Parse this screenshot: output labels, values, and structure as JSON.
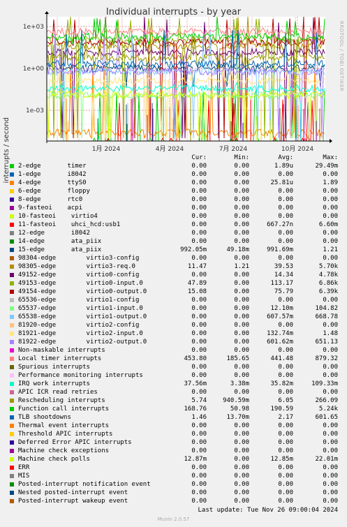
{
  "title": "Individual interrupts - by year",
  "side_label": "RRDTOOL / TOBI OETIKER",
  "munin_version": "Munin 2.0.57",
  "last_update": "Last update: Tue Nov 26 09:00:04 2024",
  "columns": {
    "cur": "Cur:",
    "min": "Min:",
    "avg": "Avg:",
    "max": "Max:"
  },
  "chart_data": {
    "type": "line",
    "title": "Individual interrupts - by year",
    "ylabel": "interrupts / second",
    "yscale": "log",
    "y_ticks": [
      "1e+03",
      "1e+00",
      "1e-03"
    ],
    "x_ticks": [
      "1月 2024",
      "4月 2024",
      "7月 2024",
      "10月 2024"
    ],
    "grid": true,
    "legend_placement": "bottom",
    "series_summary": [
      {
        "name": "2-edge       timer",
        "color": "#00cc00",
        "cur": "0.00",
        "min": "0.00",
        "avg": "1.89u",
        "max": "29.49m"
      },
      {
        "name": "1-edge       i8042",
        "color": "#0066b3",
        "cur": "0.00",
        "min": "0.00",
        "avg": "0.00",
        "max": "0.00"
      },
      {
        "name": "4-edge       ttyS0",
        "color": "#ff8000",
        "cur": "0.00",
        "min": "0.00",
        "avg": "25.81u",
        "max": "1.89"
      },
      {
        "name": "6-edge       floppy",
        "color": "#ffcc00",
        "cur": "0.00",
        "min": "0.00",
        "avg": "0.00",
        "max": "0.00"
      },
      {
        "name": "8-edge       rtc0",
        "color": "#330099",
        "cur": "0.00",
        "min": "0.00",
        "avg": "0.00",
        "max": "0.00"
      },
      {
        "name": "9-fasteoi    acpi",
        "color": "#990099",
        "cur": "0.00",
        "min": "0.00",
        "avg": "0.00",
        "max": "0.00"
      },
      {
        "name": "10-fasteoi    virtio4",
        "color": "#ccff00",
        "cur": "0.00",
        "min": "0.00",
        "avg": "0.00",
        "max": "0.00"
      },
      {
        "name": "11-fasteoi    uhci_hcd:usb1",
        "color": "#ff0000",
        "cur": "0.00",
        "min": "0.00",
        "avg": "667.27n",
        "max": "6.60m"
      },
      {
        "name": "12-edge       i8042",
        "color": "#808080",
        "cur": "0.00",
        "min": "0.00",
        "avg": "0.00",
        "max": "0.00"
      },
      {
        "name": "14-edge       ata_piix",
        "color": "#008f00",
        "cur": "0.00",
        "min": "0.00",
        "avg": "0.00",
        "max": "0.00"
      },
      {
        "name": "15-edge       ata_piix",
        "color": "#00487d",
        "cur": "992.05m",
        "min": "49.18m",
        "avg": "991.69m",
        "max": "1.21"
      },
      {
        "name": "98304-edge        virtio3-config",
        "color": "#b35a00",
        "cur": "0.00",
        "min": "0.00",
        "avg": "0.00",
        "max": "0.00"
      },
      {
        "name": "98305-edge        virtio3-req.0",
        "color": "#b38f00",
        "cur": "11.47",
        "min": "1.21",
        "avg": "39.53",
        "max": "5.70k"
      },
      {
        "name": "49152-edge        virtio0-config",
        "color": "#6b006b",
        "cur": "0.00",
        "min": "0.00",
        "avg": "14.34",
        "max": "4.78k"
      },
      {
        "name": "49153-edge        virtio0-input.0",
        "color": "#8fb300",
        "cur": "47.89",
        "min": "0.00",
        "avg": "113.17",
        "max": "6.86k"
      },
      {
        "name": "49154-edge        virtio0-output.0",
        "color": "#b30000",
        "cur": "15.08",
        "min": "0.00",
        "avg": "75.79",
        "max": "6.39k"
      },
      {
        "name": "65536-edge        virtio1-config",
        "color": "#bebebe",
        "cur": "0.00",
        "min": "0.00",
        "avg": "0.00",
        "max": "0.00"
      },
      {
        "name": "65537-edge        virtio1-input.0",
        "color": "#80ff80",
        "cur": "0.00",
        "min": "0.00",
        "avg": "12.10m",
        "max": "104.82"
      },
      {
        "name": "65538-edge        virtio1-output.0",
        "color": "#80c9ff",
        "cur": "0.00",
        "min": "0.00",
        "avg": "607.57m",
        "max": "668.78"
      },
      {
        "name": "81920-edge        virtio2-config",
        "color": "#ffc080",
        "cur": "0.00",
        "min": "0.00",
        "avg": "0.00",
        "max": "0.00"
      },
      {
        "name": "81921-edge        virtio2-input.0",
        "color": "#ffe680",
        "cur": "0.00",
        "min": "0.00",
        "avg": "132.74m",
        "max": "1.48"
      },
      {
        "name": "81922-edge        virtio2-output.0",
        "color": "#aa80ff",
        "cur": "0.00",
        "min": "0.00",
        "avg": "601.62m",
        "max": "651.13"
      },
      {
        "name": "Non-maskable interrupts",
        "color": "#ee00cc",
        "cur": "0.00",
        "min": "0.00",
        "avg": "0.00",
        "max": "0.00"
      },
      {
        "name": "Local timer interrupts",
        "color": "#ff8080",
        "cur": "453.80",
        "min": "185.65",
        "avg": "441.48",
        "max": "879.32"
      },
      {
        "name": "Spurious interrupts",
        "color": "#666600",
        "cur": "0.00",
        "min": "0.00",
        "avg": "0.00",
        "max": "0.00"
      },
      {
        "name": "Performance monitoring interrupts",
        "color": "#ffbfff",
        "cur": "0.00",
        "min": "0.00",
        "avg": "0.00",
        "max": "0.00"
      },
      {
        "name": "IRQ work interrupts",
        "color": "#00ffcc",
        "cur": "37.56m",
        "min": "3.38m",
        "avg": "35.82m",
        "max": "109.33m"
      },
      {
        "name": "APIC ICR read retries",
        "color": "#cc6699",
        "cur": "0.00",
        "min": "0.00",
        "avg": "0.00",
        "max": "0.00"
      },
      {
        "name": "Rescheduling interrupts",
        "color": "#999900",
        "cur": "5.74",
        "min": "940.59m",
        "avg": "6.05",
        "max": "266.09"
      },
      {
        "name": "Function call interrupts",
        "color": "#00cc00",
        "cur": "168.76",
        "min": "50.98",
        "avg": "190.59",
        "max": "5.24k"
      },
      {
        "name": "TLB shootdowns",
        "color": "#0066b3",
        "cur": "1.46",
        "min": "13.70m",
        "avg": "2.17",
        "max": "601.65"
      },
      {
        "name": "Thermal event interrupts",
        "color": "#ff8000",
        "cur": "0.00",
        "min": "0.00",
        "avg": "0.00",
        "max": "0.00"
      },
      {
        "name": "Threshold APIC interrupts",
        "color": "#ffcc00",
        "cur": "0.00",
        "min": "0.00",
        "avg": "0.00",
        "max": "0.00"
      },
      {
        "name": "Deferred Error APIC interrupts",
        "color": "#330099",
        "cur": "0.00",
        "min": "0.00",
        "avg": "0.00",
        "max": "0.00"
      },
      {
        "name": "Machine check exceptions",
        "color": "#990099",
        "cur": "0.00",
        "min": "0.00",
        "avg": "0.00",
        "max": "0.00"
      },
      {
        "name": "Machine check polls",
        "color": "#ccff00",
        "cur": "12.87m",
        "min": "0.00",
        "avg": "12.85m",
        "max": "22.01m"
      },
      {
        "name": "ERR",
        "color": "#ff0000",
        "cur": "0.00",
        "min": "0.00",
        "avg": "0.00",
        "max": "0.00"
      },
      {
        "name": "MIS",
        "color": "#808080",
        "cur": "0.00",
        "min": "0.00",
        "avg": "0.00",
        "max": "0.00"
      },
      {
        "name": "Posted-interrupt notification event",
        "color": "#008f00",
        "cur": "0.00",
        "min": "0.00",
        "avg": "0.00",
        "max": "0.00"
      },
      {
        "name": "Nested posted-interrupt event",
        "color": "#00487d",
        "cur": "0.00",
        "min": "0.00",
        "avg": "0.00",
        "max": "0.00"
      },
      {
        "name": "Posted-interrupt wakeup event",
        "color": "#b35a00",
        "cur": "0.00",
        "min": "0.00",
        "avg": "0.00",
        "max": "0.00"
      }
    ]
  }
}
